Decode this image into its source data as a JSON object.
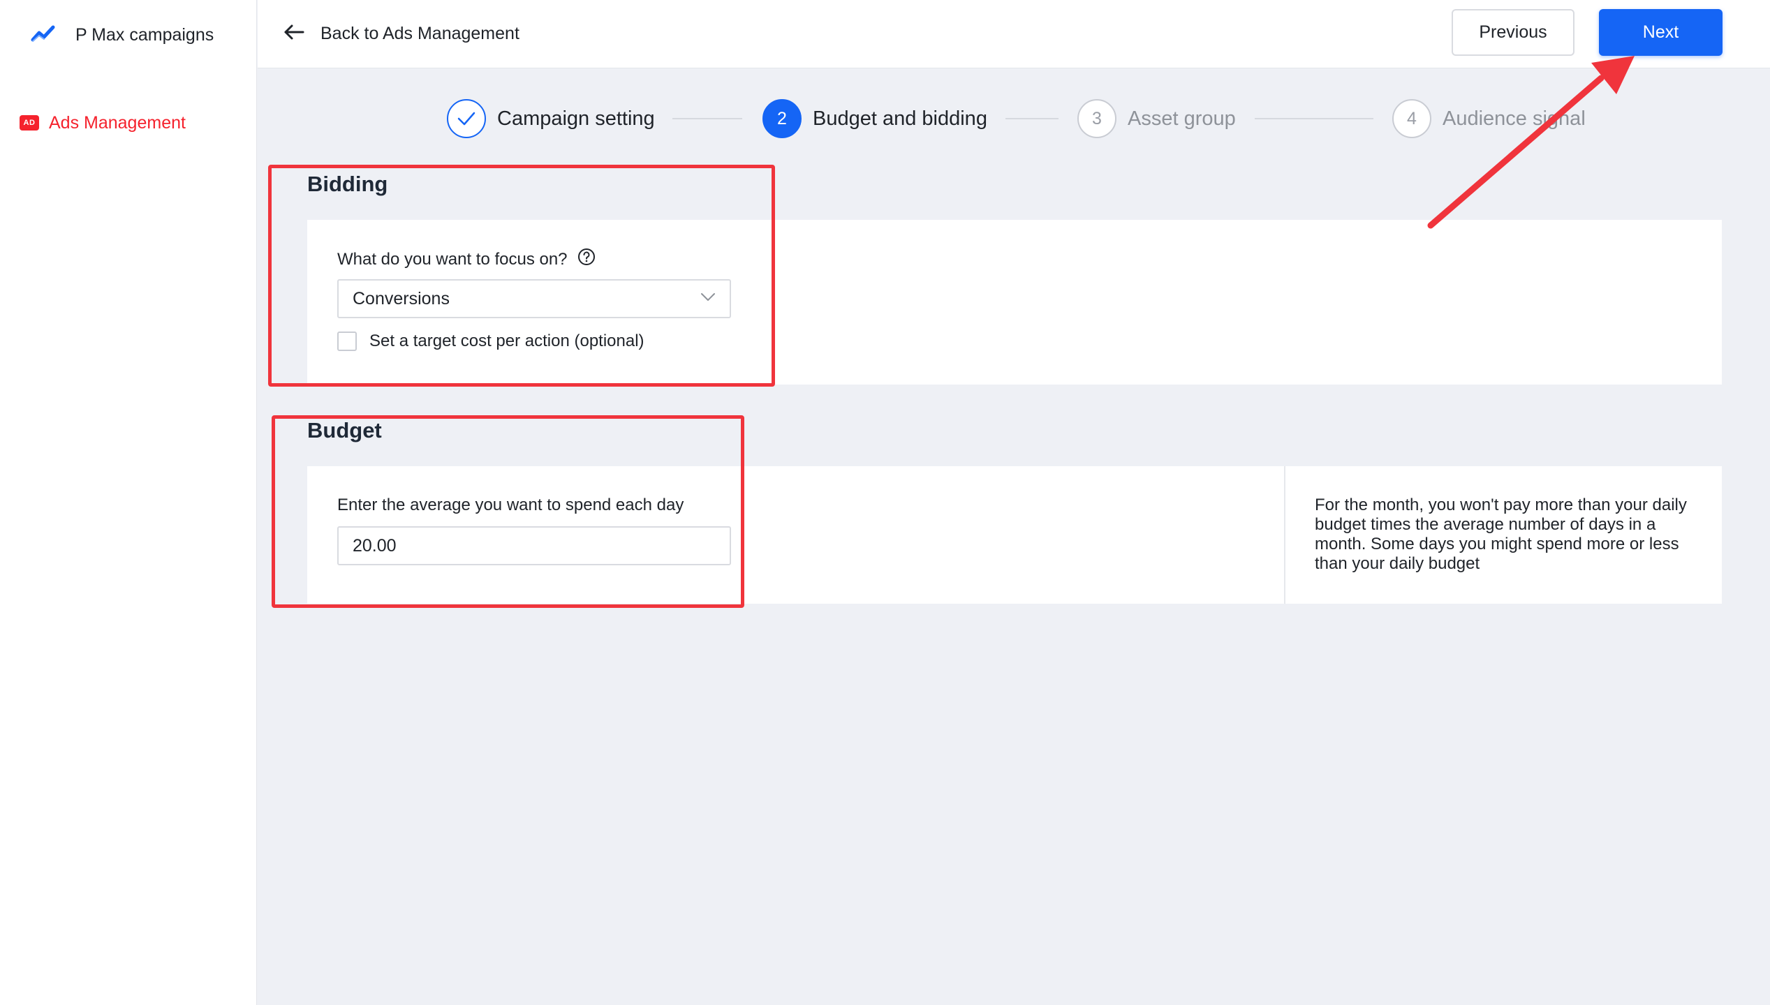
{
  "sidebar": {
    "brand_title": "P Max campaigns",
    "brand_icon": "trend-chart-icon",
    "nav": [
      {
        "label": "Ads Management",
        "icon": "ad-badge-icon",
        "icon_text": "AD",
        "active": true
      }
    ]
  },
  "topbar": {
    "back_label": "Back to Ads Management",
    "previous_label": "Previous",
    "next_label": "Next"
  },
  "stepper": {
    "steps": [
      {
        "number": "1",
        "label": "Campaign setting",
        "state": "done"
      },
      {
        "number": "2",
        "label": "Budget and bidding",
        "state": "active"
      },
      {
        "number": "3",
        "label": "Asset group",
        "state": "pending"
      },
      {
        "number": "4",
        "label": "Audience signal",
        "state": "pending"
      }
    ]
  },
  "bidding": {
    "title": "Bidding",
    "focus_label": "What do you want to focus on?",
    "focus_value": "Conversions",
    "target_cpa_label": "Set a target cost per action (optional)",
    "target_cpa_checked": false
  },
  "budget": {
    "title": "Budget",
    "daily_label": "Enter the average you want to spend each day",
    "daily_value": "20.00",
    "note": "For the month, you won't pay more than your daily budget times the average number of days in a month. Some days you might spend more or less than your daily budget"
  },
  "colors": {
    "accent": "#1565f5",
    "annotation": "#f0343c",
    "nav_active": "#f5222d",
    "background": "#eef0f5"
  }
}
